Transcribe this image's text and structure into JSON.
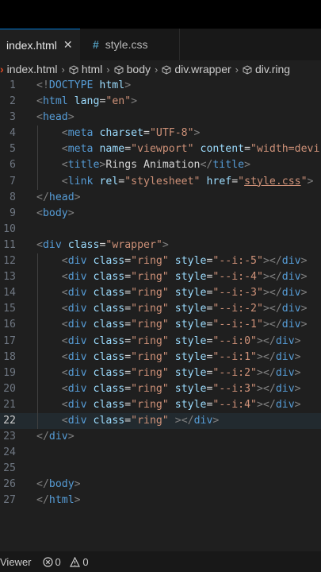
{
  "tabs": [
    {
      "label": "index.html",
      "close": "✕",
      "active": true
    },
    {
      "label": "style.css",
      "icon": "#",
      "active": false
    }
  ],
  "breadcrumb": [
    "index.html",
    "html",
    "body",
    "div.wrapper",
    "div.ring"
  ],
  "status": {
    "viewer": "Viewer",
    "errors": "0",
    "warnings": "0"
  },
  "code_lines": [
    {
      "n": "1",
      "html": "<span class='br'>&lt;!</span><span class='tag'>DOCTYPE</span> <span class='attr'>html</span><span class='br'>&gt;</span>"
    },
    {
      "n": "2",
      "html": "<span class='br'>&lt;</span><span class='tag'>html</span> <span class='attr'>lang</span><span class='plain'>=</span><span class='str'>\"en\"</span><span class='br'>&gt;</span>"
    },
    {
      "n": "3",
      "html": "<span class='br'>&lt;</span><span class='tag'>head</span><span class='br'>&gt;</span>"
    },
    {
      "n": "4",
      "html": "    <span class='br'>&lt;</span><span class='tag'>meta</span> <span class='attr'>charset</span><span class='plain'>=</span><span class='str'>\"UTF-8\"</span><span class='br'>&gt;</span>"
    },
    {
      "n": "5",
      "html": "    <span class='br'>&lt;</span><span class='tag'>meta</span> <span class='attr'>name</span><span class='plain'>=</span><span class='str'>\"viewport\"</span> <span class='attr'>content</span><span class='plain'>=</span><span class='str'>\"width=devi</span>"
    },
    {
      "n": "6",
      "html": "    <span class='br'>&lt;</span><span class='tag'>title</span><span class='br'>&gt;</span><span class='plain'>Rings Animation</span><span class='br'>&lt;/</span><span class='tag'>title</span><span class='br'>&gt;</span>"
    },
    {
      "n": "7",
      "html": "    <span class='br'>&lt;</span><span class='tag'>link</span> <span class='attr'>rel</span><span class='plain'>=</span><span class='str'>\"stylesheet\"</span> <span class='attr'>href</span><span class='plain'>=</span><span class='str'>\"</span><span class='link'>style.css</span><span class='str'>\"</span><span class='br'>&gt;</span>"
    },
    {
      "n": "8",
      "html": "<span class='br'>&lt;/</span><span class='tag'>head</span><span class='br'>&gt;</span>"
    },
    {
      "n": "9",
      "html": "<span class='br'>&lt;</span><span class='tag'>body</span><span class='br'>&gt;</span>"
    },
    {
      "n": "10",
      "html": ""
    },
    {
      "n": "11",
      "html": "<span class='br'>&lt;</span><span class='tag'>div</span> <span class='attr'>class</span><span class='plain'>=</span><span class='str'>\"wrapper\"</span><span class='br'>&gt;</span>"
    },
    {
      "n": "12",
      "html": "    <span class='br'>&lt;</span><span class='tag'>div</span> <span class='attr'>class</span><span class='plain'>=</span><span class='str'>\"ring\"</span> <span class='attr'>style</span><span class='plain'>=</span><span class='str'>\"--i:-5\"</span><span class='br'>&gt;&lt;/</span><span class='tag'>div</span><span class='br'>&gt;</span>"
    },
    {
      "n": "13",
      "html": "    <span class='br'>&lt;</span><span class='tag'>div</span> <span class='attr'>class</span><span class='plain'>=</span><span class='str'>\"ring\"</span> <span class='attr'>style</span><span class='plain'>=</span><span class='str'>\"--i:-4\"</span><span class='br'>&gt;&lt;/</span><span class='tag'>div</span><span class='br'>&gt;</span>"
    },
    {
      "n": "14",
      "html": "    <span class='br'>&lt;</span><span class='tag'>div</span> <span class='attr'>class</span><span class='plain'>=</span><span class='str'>\"ring\"</span> <span class='attr'>style</span><span class='plain'>=</span><span class='str'>\"--i:-3\"</span><span class='br'>&gt;&lt;/</span><span class='tag'>div</span><span class='br'>&gt;</span>"
    },
    {
      "n": "15",
      "html": "    <span class='br'>&lt;</span><span class='tag'>div</span> <span class='attr'>class</span><span class='plain'>=</span><span class='str'>\"ring\"</span> <span class='attr'>style</span><span class='plain'>=</span><span class='str'>\"--i:-2\"</span><span class='br'>&gt;&lt;/</span><span class='tag'>div</span><span class='br'>&gt;</span>"
    },
    {
      "n": "16",
      "html": "    <span class='br'>&lt;</span><span class='tag'>div</span> <span class='attr'>class</span><span class='plain'>=</span><span class='str'>\"ring\"</span> <span class='attr'>style</span><span class='plain'>=</span><span class='str'>\"--i:-1\"</span><span class='br'>&gt;&lt;/</span><span class='tag'>div</span><span class='br'>&gt;</span>"
    },
    {
      "n": "17",
      "html": "    <span class='br'>&lt;</span><span class='tag'>div</span> <span class='attr'>class</span><span class='plain'>=</span><span class='str'>\"ring\"</span> <span class='attr'>style</span><span class='plain'>=</span><span class='str'>\"--i:0\"</span><span class='br'>&gt;&lt;/</span><span class='tag'>div</span><span class='br'>&gt;</span>"
    },
    {
      "n": "18",
      "html": "    <span class='br'>&lt;</span><span class='tag'>div</span> <span class='attr'>class</span><span class='plain'>=</span><span class='str'>\"ring\"</span> <span class='attr'>style</span><span class='plain'>=</span><span class='str'>\"--i:1\"</span><span class='br'>&gt;&lt;/</span><span class='tag'>div</span><span class='br'>&gt;</span>"
    },
    {
      "n": "19",
      "html": "    <span class='br'>&lt;</span><span class='tag'>div</span> <span class='attr'>class</span><span class='plain'>=</span><span class='str'>\"ring\"</span> <span class='attr'>style</span><span class='plain'>=</span><span class='str'>\"--i:2\"</span><span class='br'>&gt;&lt;/</span><span class='tag'>div</span><span class='br'>&gt;</span>"
    },
    {
      "n": "20",
      "html": "    <span class='br'>&lt;</span><span class='tag'>div</span> <span class='attr'>class</span><span class='plain'>=</span><span class='str'>\"ring\"</span> <span class='attr'>style</span><span class='plain'>=</span><span class='str'>\"--i:3\"</span><span class='br'>&gt;&lt;/</span><span class='tag'>div</span><span class='br'>&gt;</span>"
    },
    {
      "n": "21",
      "html": "    <span class='br'>&lt;</span><span class='tag'>div</span> <span class='attr'>class</span><span class='plain'>=</span><span class='str'>\"ring\"</span> <span class='attr'>style</span><span class='plain'>=</span><span class='str'>\"--i:4\"</span><span class='br'>&gt;&lt;/</span><span class='tag'>div</span><span class='br'>&gt;</span>"
    },
    {
      "n": "22",
      "html": "    <span class='br'>&lt;</span><span class='tag'>div</span> <span class='attr'>class</span><span class='plain'>=</span><span class='str'>\"ring\"</span> <span class='br'>&gt;&lt;/</span><span class='tag'>div</span><span class='br'>&gt;</span>",
      "current": true
    },
    {
      "n": "23",
      "html": "<span class='br'>&lt;/</span><span class='tag'>div</span><span class='br'>&gt;</span>"
    },
    {
      "n": "24",
      "html": ""
    },
    {
      "n": "25",
      "html": ""
    },
    {
      "n": "26",
      "html": "<span class='br'>&lt;/</span><span class='tag'>body</span><span class='br'>&gt;</span>"
    },
    {
      "n": "27",
      "html": "<span class='br'>&lt;/</span><span class='tag'>html</span><span class='br'>&gt;</span>"
    }
  ]
}
